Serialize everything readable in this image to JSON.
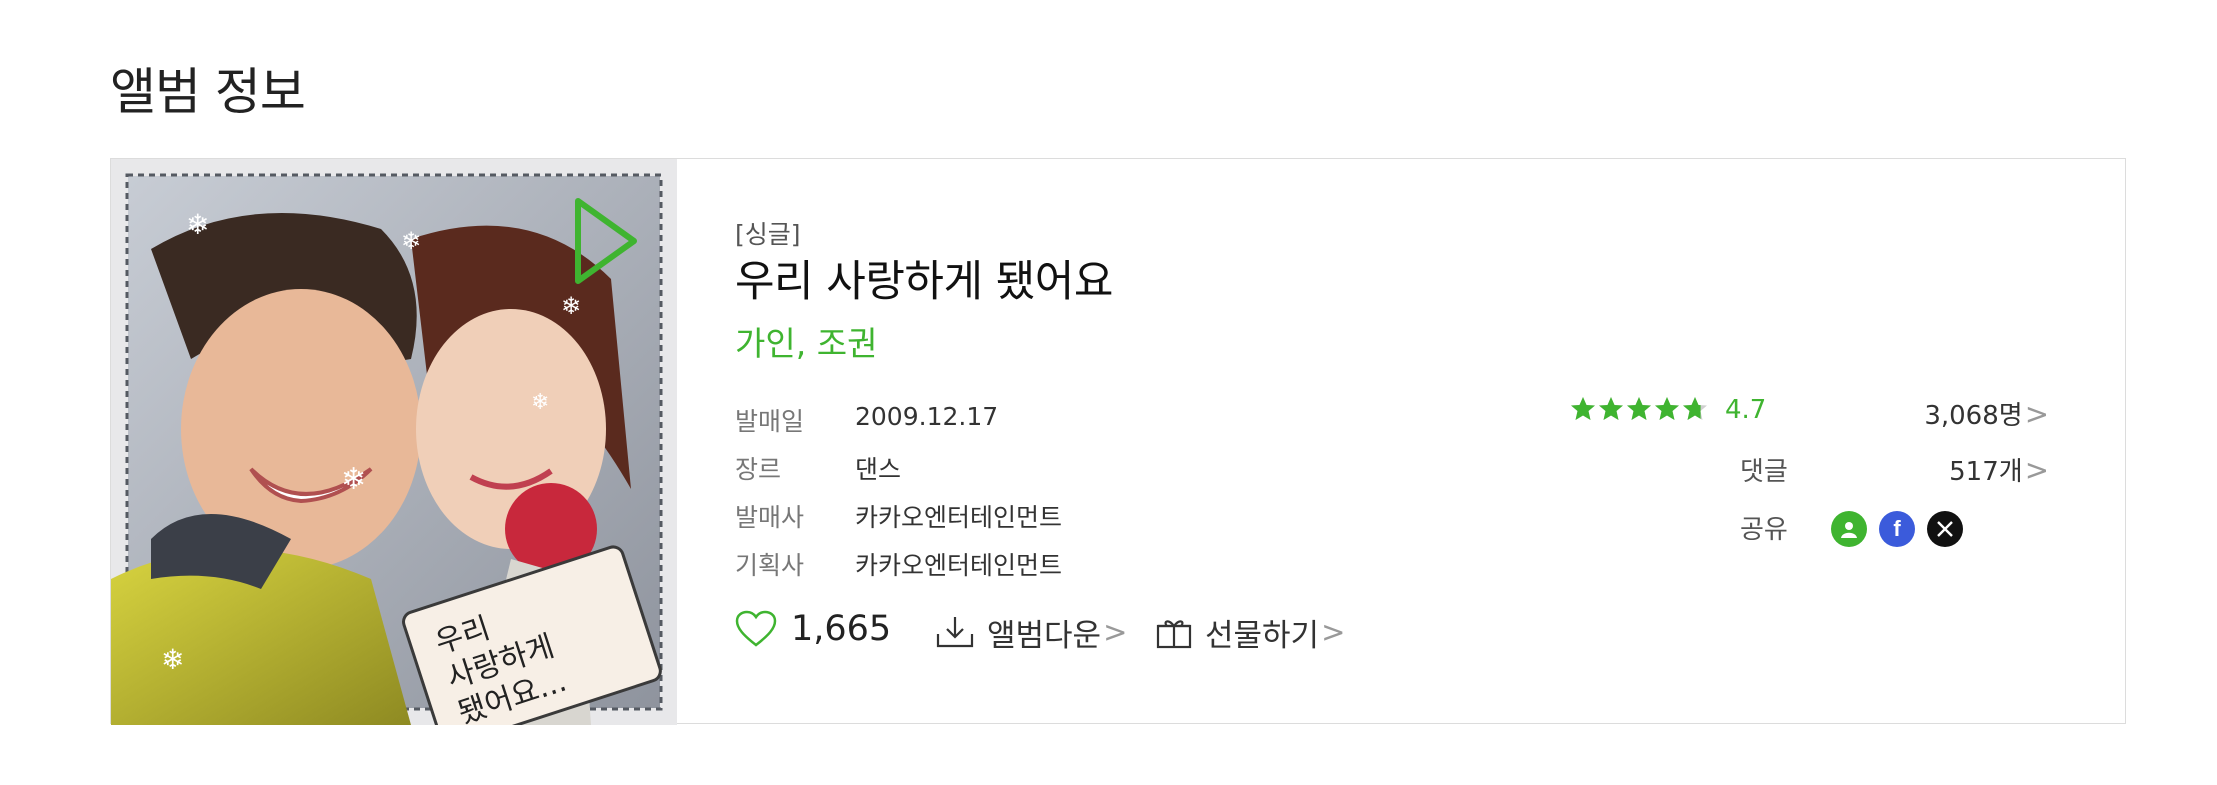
{
  "section_title": "앨범 정보",
  "album": {
    "type": "[싱글]",
    "title": "우리 사랑하게 됐어요",
    "artists": [
      "가인",
      "조권"
    ],
    "artist_separator": ",",
    "cover_caption": [
      "우리",
      "사랑하게",
      "됐어요..."
    ],
    "meta": [
      {
        "label": "발매일",
        "value": "2009.12.17"
      },
      {
        "label": "장르",
        "value": "댄스"
      },
      {
        "label": "발매사",
        "value": "카카오엔터테인먼트"
      },
      {
        "label": "기획사",
        "value": "카카오엔터테인먼트"
      }
    ],
    "actions": {
      "like_count": "1,665",
      "download_label": "앨범다운",
      "gift_label": "선물하기",
      "chevron": ">"
    },
    "stats": {
      "rating_value": "4.7",
      "rating_stars": 4.7,
      "rating_count": "3,068명",
      "comments_label": "댓글",
      "comments_count": "517개",
      "share_label": "공유",
      "chevron": ">"
    },
    "colors": {
      "accent": "#3fb430",
      "facebook": "#3b5bdb",
      "x": "#111111",
      "melon": "#3fb430"
    }
  }
}
